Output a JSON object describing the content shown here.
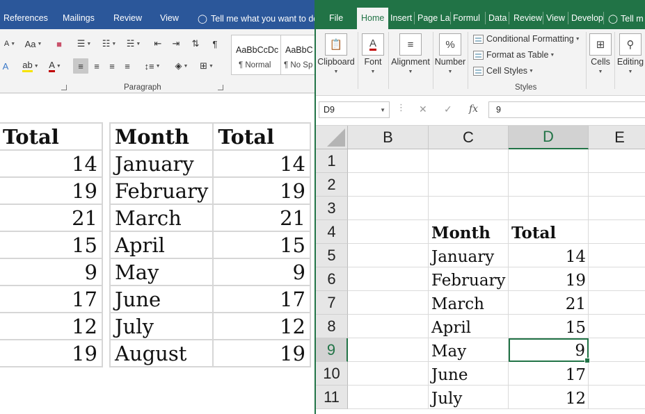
{
  "word": {
    "tabs": [
      "References",
      "Mailings",
      "Review",
      "View"
    ],
    "tell_me": "Tell me what you want to do",
    "ribbon": {
      "font_size_down": "A",
      "change_case": "Aa",
      "paragraph_label": "Paragraph",
      "pilcrow": "¶",
      "styles": [
        {
          "sample": "AaBbCcDc",
          "name": "¶ Normal"
        },
        {
          "sample": "AaBbC",
          "name": "¶ No Sp"
        }
      ]
    },
    "tables": [
      {
        "header": [
          "Total"
        ],
        "rows": [
          [
            "14"
          ],
          [
            "19"
          ],
          [
            "21"
          ],
          [
            "15"
          ],
          [
            "9"
          ],
          [
            "17"
          ],
          [
            "12"
          ],
          [
            "19"
          ]
        ]
      },
      {
        "header": [
          "Month",
          "Total"
        ],
        "rows": [
          [
            "January",
            "14"
          ],
          [
            "February",
            "19"
          ],
          [
            "March",
            "21"
          ],
          [
            "April",
            "15"
          ],
          [
            "May",
            "9"
          ],
          [
            "June",
            "17"
          ],
          [
            "July",
            "12"
          ],
          [
            "August",
            "19"
          ]
        ]
      }
    ]
  },
  "excel": {
    "tabs": [
      "File",
      "Home",
      "Insert",
      "Page La",
      "Formul",
      "Data",
      "Review",
      "View",
      "Develop",
      "Tell m"
    ],
    "selected_tab": "Home",
    "ribbon": {
      "clipboard": "Clipboard",
      "font": "Font",
      "alignment": "Alignment",
      "number": "Number",
      "number_icon": "%",
      "font_icon": "A",
      "conditional_formatting": "Conditional Formatting",
      "format_as_table": "Format as Table",
      "cell_styles": "Cell Styles",
      "styles_group": "Styles",
      "cells": "Cells",
      "editing": "Editing"
    },
    "name_box": "D9",
    "formula_value": "9",
    "fx": "fx",
    "columns": [
      "B",
      "C",
      "D",
      "E"
    ],
    "selected_column": "D",
    "row_numbers": [
      "1",
      "2",
      "3",
      "4",
      "5",
      "6",
      "7",
      "8",
      "9",
      "10",
      "11"
    ],
    "selected_row": "9",
    "table_header": [
      "Month",
      "Total"
    ],
    "table_rows": [
      [
        "January",
        "14"
      ],
      [
        "February",
        "19"
      ],
      [
        "March",
        "21"
      ],
      [
        "April",
        "15"
      ],
      [
        "May",
        "9"
      ],
      [
        "June",
        "17"
      ],
      [
        "July",
        "12"
      ]
    ]
  },
  "colors": {
    "word_blue": "#2b579a",
    "excel_green": "#217346"
  }
}
